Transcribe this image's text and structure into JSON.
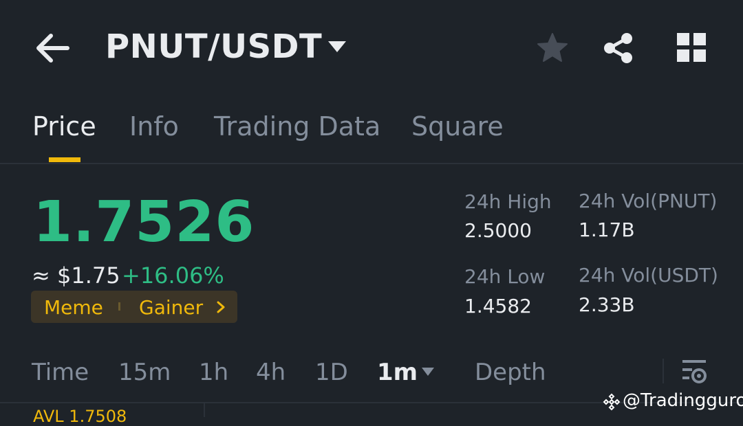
{
  "header": {
    "back_icon": "arrow-left-icon",
    "pair": "PNUT/USDT",
    "dropdown_icon": "caret-down-icon",
    "favorite_icon": "star-icon",
    "share_icon": "share-icon",
    "apps_icon": "grid-icon"
  },
  "tabs": [
    {
      "label": "Price",
      "active": true
    },
    {
      "label": "Info"
    },
    {
      "label": "Trading Data"
    },
    {
      "label": "Square"
    }
  ],
  "price": {
    "last": "1.7526",
    "approx_usd": "≈ $1.75",
    "change": "+16.06%",
    "tags": [
      "Meme",
      "Gainer"
    ],
    "tag_more_icon": "chevron-right-icon"
  },
  "stats": {
    "high_label": "24h High",
    "high": "2.5000",
    "low_label": "24h Low",
    "low": "1.4582",
    "vol_base_label": "24h Vol(PNUT)",
    "vol_base": "1.17B",
    "vol_quote_label": "24h Vol(USDT)",
    "vol_quote": "2.33B"
  },
  "timeframes": [
    "Time",
    "15m",
    "1h",
    "4h",
    "1D",
    "1m",
    "Depth"
  ],
  "timeframe_active": "1m",
  "chart_settings_icon": "chart-settings-icon",
  "avl_label": "AVL 1.7508",
  "watermark": "@Tradingguro",
  "colors": {
    "up": "#2ebd85",
    "accent": "#f0b90b",
    "bg": "#1e2329",
    "muted": "#848e9c"
  }
}
